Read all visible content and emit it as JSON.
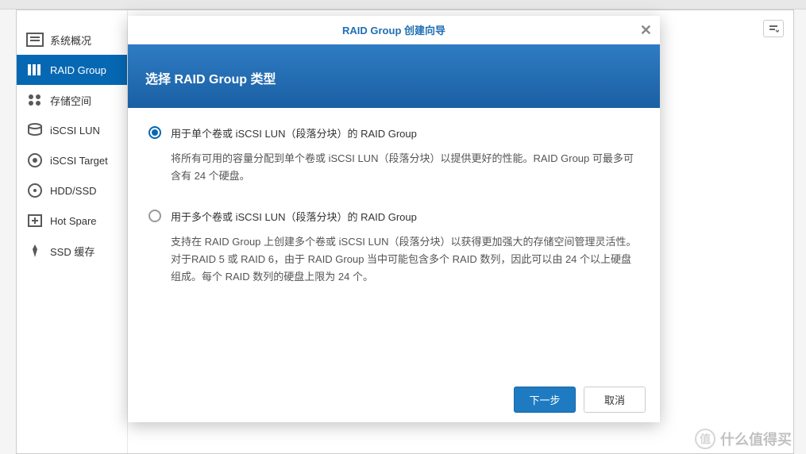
{
  "sidebar": {
    "items": [
      {
        "label": "系统概况"
      },
      {
        "label": "RAID Group"
      },
      {
        "label": "存储空间"
      },
      {
        "label": "iSCSI LUN"
      },
      {
        "label": "iSCSI Target"
      },
      {
        "label": "HDD/SSD"
      },
      {
        "label": "Hot Spare"
      },
      {
        "label": "SSD 缓存"
      }
    ]
  },
  "modal": {
    "title": "RAID Group 创建向导",
    "banner": "选择 RAID Group 类型",
    "option1": {
      "label": "用于单个卷或 iSCSI LUN（段落分块）的 RAID Group",
      "desc": "将所有可用的容量分配到单个卷或 iSCSI LUN（段落分块）以提供更好的性能。RAID Group 可最多可含有 24 个硬盘。"
    },
    "option2": {
      "label": "用于多个卷或 iSCSI LUN（段落分块）的 RAID Group",
      "desc": "支持在 RAID Group 上创建多个卷或 iSCSI LUN（段落分块）以获得更加强大的存储空间管理灵活性。对于RAID 5 或 RAID 6，由于 RAID Group 当中可能包含多个 RAID 数列，因此可以由 24 个以上硬盘组成。每个 RAID 数列的硬盘上限为 24 个。"
    },
    "next": "下一步",
    "cancel": "取消"
  },
  "watermark": "什么值得买"
}
